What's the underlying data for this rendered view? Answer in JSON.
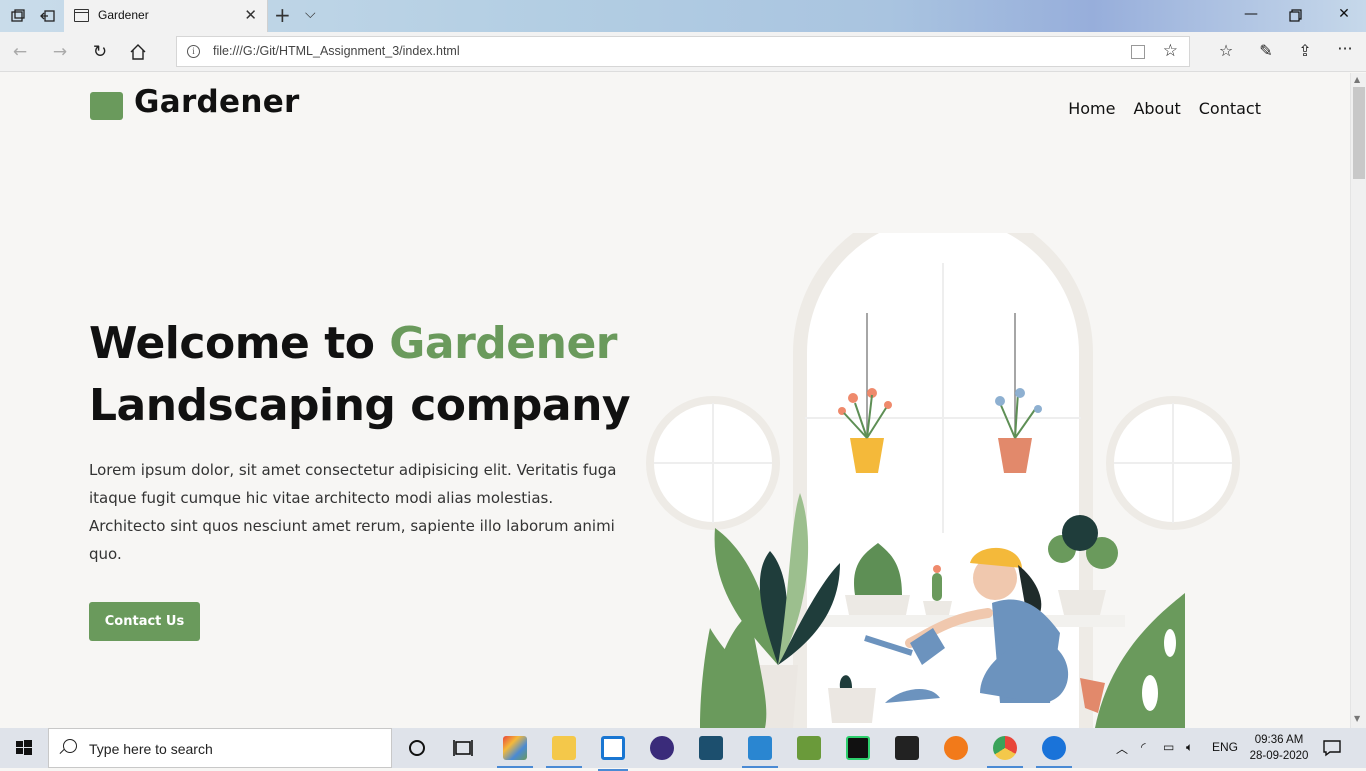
{
  "browser": {
    "tab_title": "Gardener",
    "url": "file:///G:/Git/HTML_Assignment_3/index.html"
  },
  "site": {
    "logo_text": "Gardener",
    "nav": [
      "Home",
      "About",
      "Contact"
    ],
    "hero": {
      "title_prefix": "Welcome to ",
      "title_accent": "Gardener",
      "title_line2": "Landscaping company",
      "paragraph": "Lorem ipsum dolor, sit amet consectetur adipisicing elit. Veritatis fuga itaque fugit cumque hic vitae architecto modi alias molestias. Architecto sint quos nesciunt amet rerum, sapiente illo laborum animi quo.",
      "cta_label": "Contact Us"
    },
    "colors": {
      "accent": "#6a9a5c",
      "background": "#f7f6f4",
      "text": "#111111"
    }
  },
  "taskbar": {
    "search_placeholder": "Type here to search",
    "language": "ENG",
    "time": "09:36 AM",
    "date": "28-09-2020"
  }
}
